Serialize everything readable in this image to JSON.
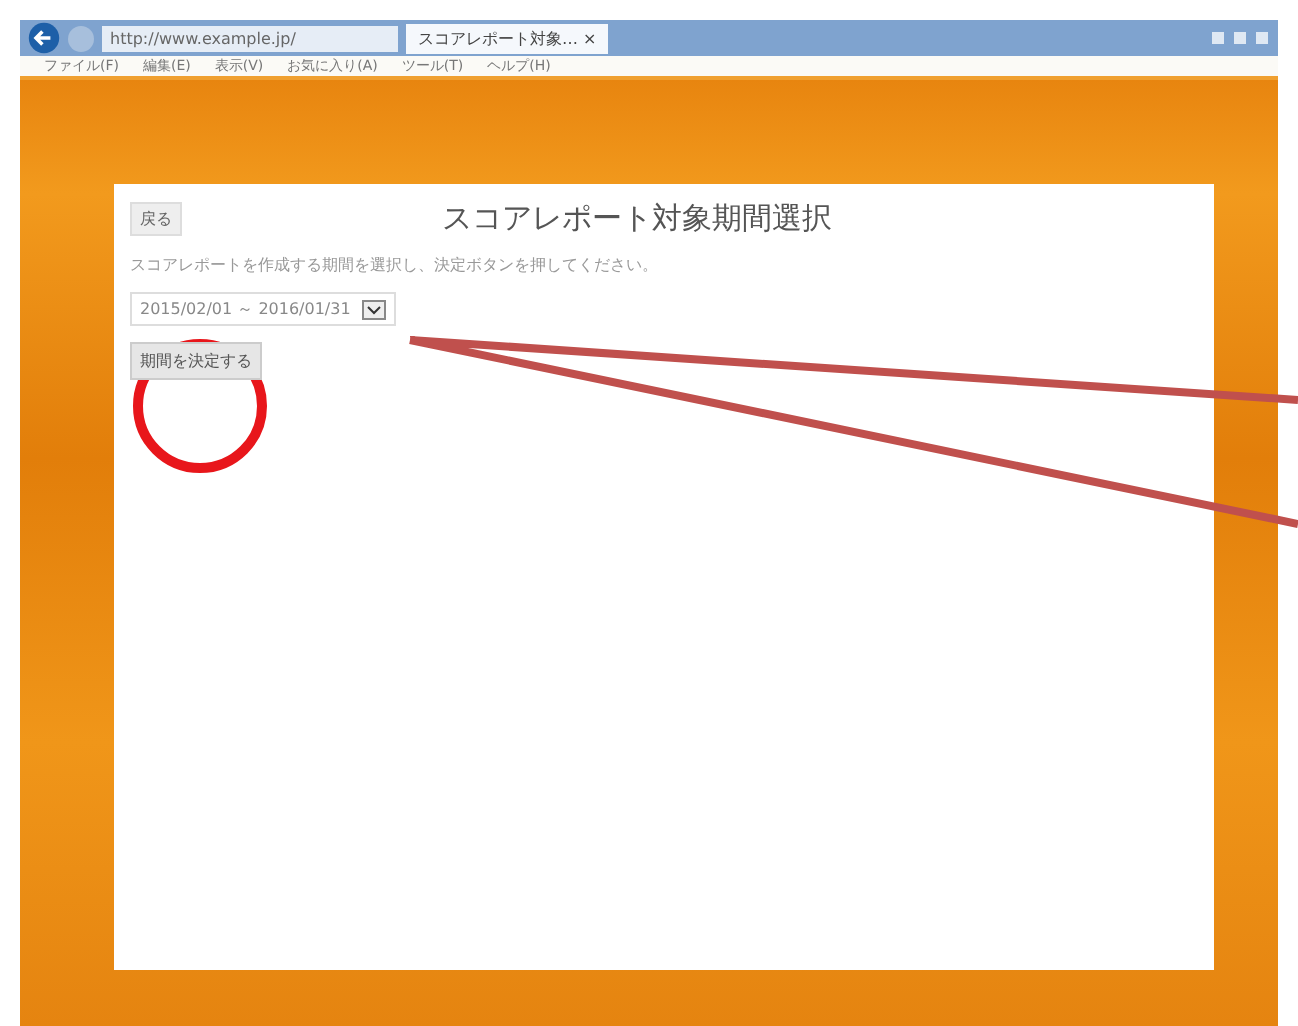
{
  "browser": {
    "address": "http://www.example.jp/",
    "tabs": [
      {
        "label": "スコアレポート対象… ×",
        "selected": true
      }
    ],
    "menu": [
      "ファイル(F)",
      "編集(E)",
      "表示(V)",
      "お気に入り(A)",
      "ツール(T)",
      "ヘルプ(H)"
    ]
  },
  "page": {
    "back_button": "戻る",
    "title": "スコアレポート対象期間選択",
    "instruction": "スコアレポートを作成する期間を選択し、決定ボタンを押してください。",
    "period_select": {
      "value": "2015/02/01 ～ 2016/01/31"
    },
    "confirm_button": "期間を決定する"
  }
}
